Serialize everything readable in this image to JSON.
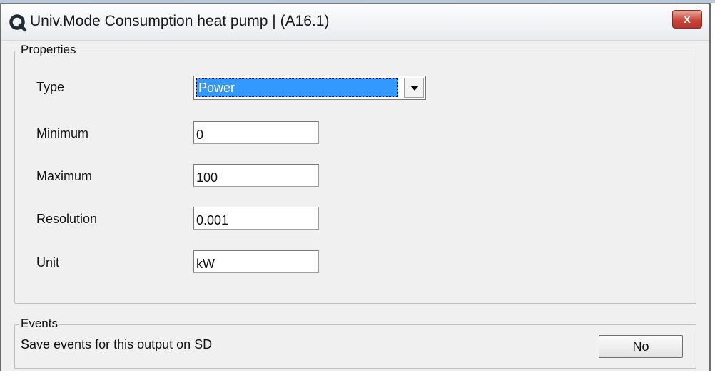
{
  "window": {
    "title": "Univ.Mode Consumption heat pump |  (A16.1)",
    "app_icon": "q-logo-icon",
    "close_icon": "close-x-icon",
    "close_symbol": "x",
    "close_color": "#c9463a"
  },
  "properties": {
    "legend": "Properties",
    "type": {
      "label": "Type",
      "selected": "Power",
      "highlight_color": "#3399ff"
    },
    "minimum": {
      "label": "Minimum",
      "value": "0"
    },
    "maximum": {
      "label": "Maximum",
      "value": "100"
    },
    "resolution": {
      "label": "Resolution",
      "value": "0.001"
    },
    "unit": {
      "label": "Unit",
      "value": "kW"
    }
  },
  "events": {
    "legend": "Events",
    "description": "Save events for this output on SD",
    "button_label": "No"
  }
}
